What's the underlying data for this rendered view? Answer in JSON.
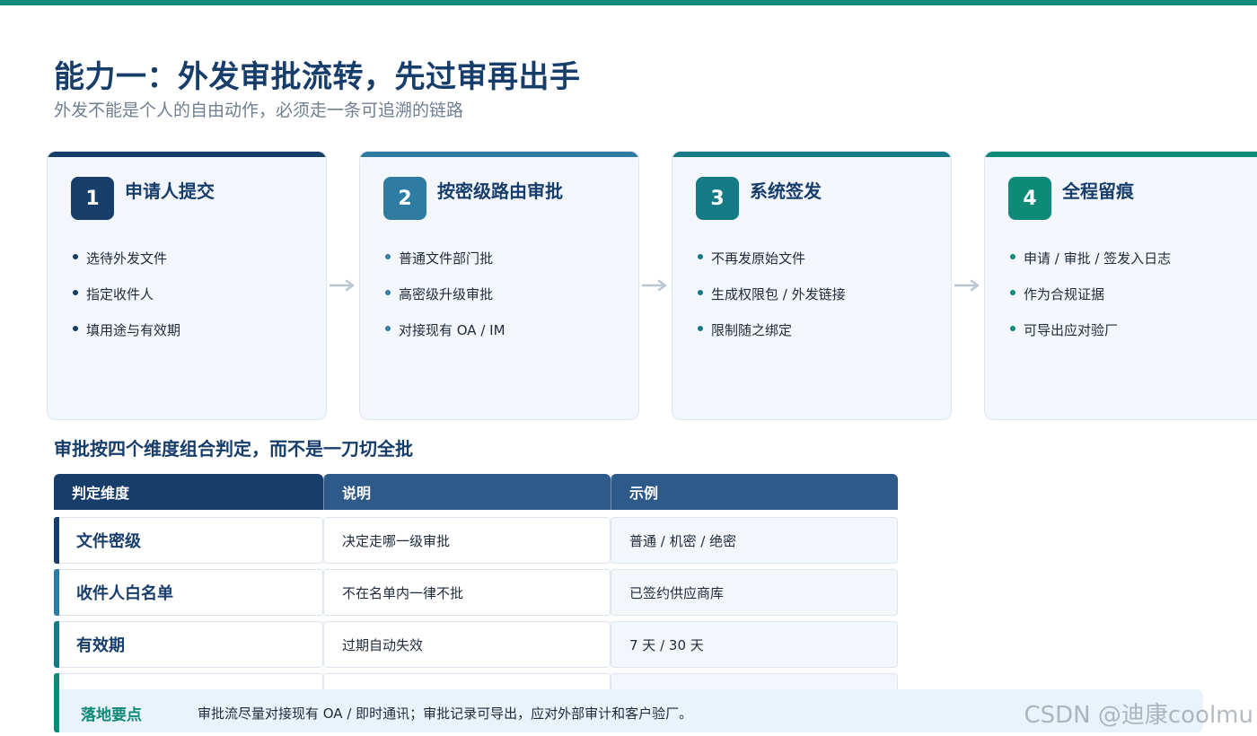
{
  "page": {
    "title": "能力一：外发审批流转，先过审再出手",
    "subtitle": "外发不能是个人的自由动作，必须走一条可追溯的链路"
  },
  "steps": [
    {
      "number": "1",
      "title": "申请人提交",
      "color": "#173d6b",
      "items": [
        "选待外发文件",
        "指定收件人",
        "填用途与有效期"
      ]
    },
    {
      "number": "2",
      "title": "按密级路由审批",
      "color": "#2f7ca3",
      "items": [
        "普通文件部门批",
        "高密级升级审批",
        "对接现有 OA / IM"
      ]
    },
    {
      "number": "3",
      "title": "系统签发",
      "color": "#137a86",
      "items": [
        "不再发原始文件",
        "生成权限包 / 外发链接",
        "限制随之绑定"
      ]
    },
    {
      "number": "4",
      "title": "全程留痕",
      "color": "#0e8a78",
      "items": [
        "申请 / 审批 / 签发入日志",
        "作为合规证据",
        "可导出应对验厂"
      ]
    }
  ],
  "arrow_icon": "arrow-right-icon",
  "section_heading": "审批按四个维度组合判定，而不是一刀切全批",
  "table": {
    "headers": [
      "判定维度",
      "说明",
      "示例"
    ],
    "header_colors": [
      "#173d6b",
      "#2e5a8a",
      "#2e5a8a"
    ],
    "rows": [
      {
        "dimension": "文件密级",
        "description": "决定走哪一级审批",
        "example": "普通 / 机密 / 绝密",
        "accent": "#173d6b"
      },
      {
        "dimension": "收件人白名单",
        "description": "不在名单内一律不批",
        "example": "已签约供应商库",
        "accent": "#2f7ca3"
      },
      {
        "dimension": "有效期",
        "description": "过期自动失效",
        "example": "7 天 / 30 天",
        "accent": "#137a86"
      }
    ],
    "partial_row_accent": "#0e8a78"
  },
  "callout": {
    "label": "落地要点",
    "text": "审批流尽量对接现有 OA / 即时通讯；审批记录可导出，应对外部审计和客户验厂。"
  },
  "watermark": "CSDN @迪康coolmu"
}
